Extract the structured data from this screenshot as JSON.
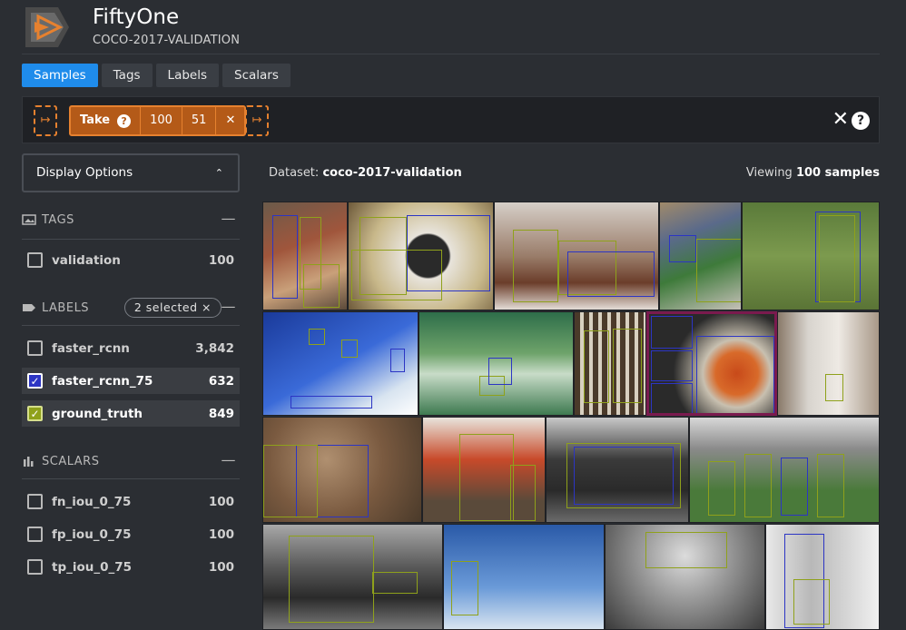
{
  "app": {
    "name": "FiftyOne",
    "dataset_title": "COCO-2017-VALIDATION",
    "colors": {
      "accent": "#1f8ceb",
      "stage_orange": "#e6812f",
      "label_blue": "#2c35c4",
      "label_green": "#8fa11b",
      "highlight": "#7a1a4e"
    }
  },
  "nav": {
    "tabs": [
      {
        "label": "Samples",
        "active": true
      },
      {
        "label": "Tags",
        "active": false
      },
      {
        "label": "Labels",
        "active": false
      },
      {
        "label": "Scalars",
        "active": false
      }
    ]
  },
  "view_bar": {
    "add_stage_icon": "arrow-right-hook-icon",
    "stage": {
      "name": "Take",
      "params": [
        "100",
        "51"
      ]
    },
    "close_icon": "close-icon",
    "help_icon": "help-icon"
  },
  "sidebar": {
    "display_options": "Display Options",
    "tags": {
      "title": "TAGS",
      "items": [
        {
          "label": "validation",
          "count": "100",
          "checked": false
        }
      ]
    },
    "labels": {
      "title": "LABELS",
      "selected_pill": "2 selected ×",
      "items": [
        {
          "label": "faster_rcnn",
          "count": "3,842",
          "checked": false
        },
        {
          "label": "faster_rcnn_75",
          "count": "632",
          "checked": true,
          "color": "#2c35c4"
        },
        {
          "label": "ground_truth",
          "count": "849",
          "checked": true,
          "color": "#8fa11b"
        }
      ]
    },
    "scalars": {
      "title": "SCALARS",
      "items": [
        {
          "label": "fn_iou_0_75",
          "count": "100",
          "checked": false
        },
        {
          "label": "fp_iou_0_75",
          "count": "100",
          "checked": false
        },
        {
          "label": "tp_iou_0_75",
          "count": "100",
          "checked": false
        }
      ]
    }
  },
  "main": {
    "dataset_prefix": "Dataset:",
    "dataset_name": "coco-2017-validation",
    "viewing_prefix": "Viewing",
    "viewing_count": "100 samples"
  }
}
